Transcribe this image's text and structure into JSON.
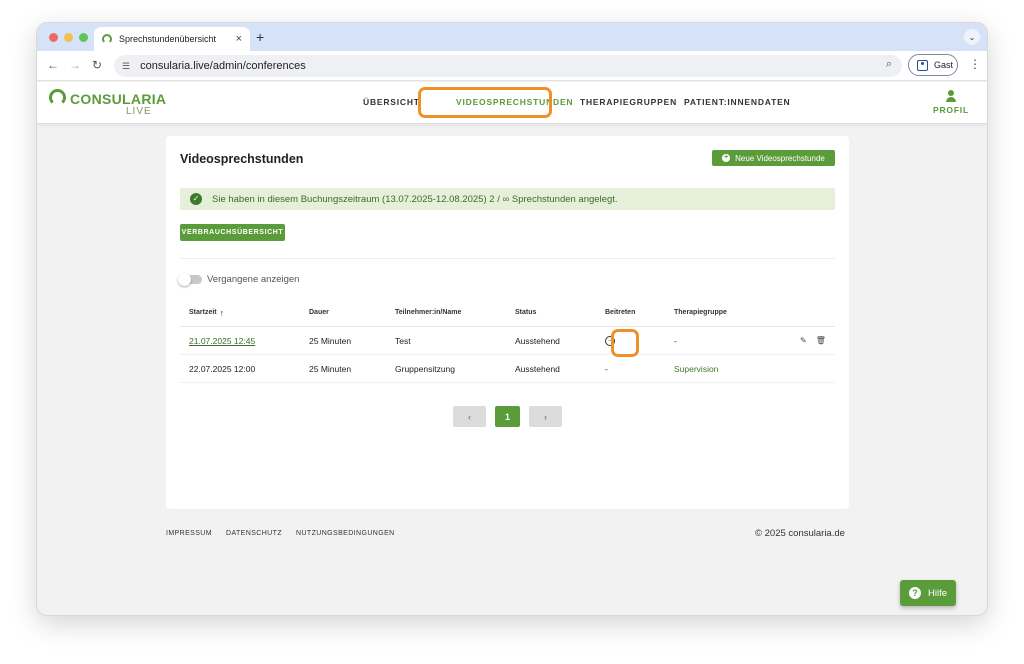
{
  "browser": {
    "tab_title": "Sprechstundenübersicht",
    "tab_close": "×",
    "new_tab": "+",
    "url": "consularia.live/admin/conferences",
    "profile_label": "Gast",
    "traffic_lights": [
      "#ed6a5e",
      "#f5bf4f",
      "#61c554"
    ]
  },
  "app": {
    "logo_text": "CONSULARIA",
    "logo_sub": "LIVE",
    "nav": [
      "ÜBERSICHT",
      "VIDEOSPRECHSTUNDEN",
      "THERAPIEGRUPPEN",
      "PATIENT:INNENDATEN"
    ],
    "active_nav": "VIDEOSPRECHSTUNDEN",
    "profile_label": "PROFIL",
    "brand_color": "#5a9b3a",
    "highlight_color": "#f0902a"
  },
  "page": {
    "title": "Videosprechstunden",
    "new_button": "Neue Videosprechstunde",
    "alert_text": "Sie haben in diesem Buchungszeitraum (13.07.2025-12.08.2025) 2 / ∞ Sprechstunden angelegt.",
    "usage_button": "VERBRAUCHSÜBERSICHT",
    "toggle_label": "Vergangene anzeigen",
    "toggle_on": false
  },
  "table": {
    "headers": [
      "Startzeit",
      "Dauer",
      "Teilnehmer:in/Name",
      "Status",
      "Beitreten",
      "Therapiegruppe"
    ],
    "sort_arrow": "↑",
    "rows": [
      {
        "start": "21.07.2025 12:45",
        "duration": "25 Minuten",
        "name": "Test",
        "status": "Ausstehend",
        "join": "",
        "group": "-"
      },
      {
        "start": "22.07.2025 12:00",
        "duration": "25 Minuten",
        "name": "Gruppensitzung",
        "status": "Ausstehend",
        "join": "-",
        "group": "Supervision"
      }
    ]
  },
  "pagination": {
    "prev": "‹",
    "current": "1",
    "next": "›"
  },
  "footer": {
    "links": [
      "IMPRESSUM",
      "DATENSCHUTZ",
      "NUTZUNGSBEDINGUNGEN"
    ],
    "copyright": "© 2025 consularia.de",
    "help": "Hilfe"
  }
}
